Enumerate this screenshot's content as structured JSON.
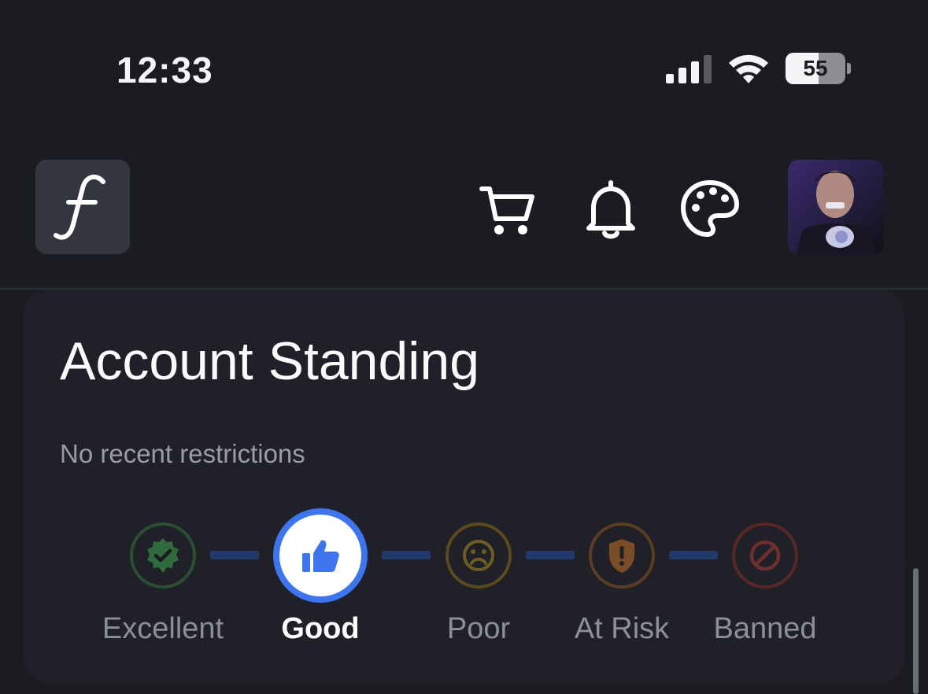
{
  "status_bar": {
    "time": "12:33",
    "battery": "55",
    "battery_level": 0.55
  },
  "header": {
    "logo_letter": "f",
    "icons": [
      "cart-icon",
      "bell-icon",
      "palette-icon"
    ]
  },
  "card": {
    "title": "Account Standing",
    "subtitle": "No recent restrictions",
    "steps": [
      {
        "label": "Excellent",
        "icon": "verified-check-icon",
        "color": "#3f8a4e",
        "active": false
      },
      {
        "label": "Good",
        "icon": "thumbs-up-icon",
        "color": "#3d74f0",
        "active": true
      },
      {
        "label": "Poor",
        "icon": "sad-face-icon",
        "color": "#8a7324",
        "active": false
      },
      {
        "label": "At Risk",
        "icon": "shield-alert-icon",
        "color": "#8f5b2c",
        "active": false
      },
      {
        "label": "Banned",
        "icon": "banned-icon",
        "color": "#8a3636",
        "active": false
      }
    ]
  },
  "colors": {
    "background": "#1b1c21",
    "card": "#202128",
    "accent": "#3d74f0",
    "connector": "#223a6b"
  }
}
